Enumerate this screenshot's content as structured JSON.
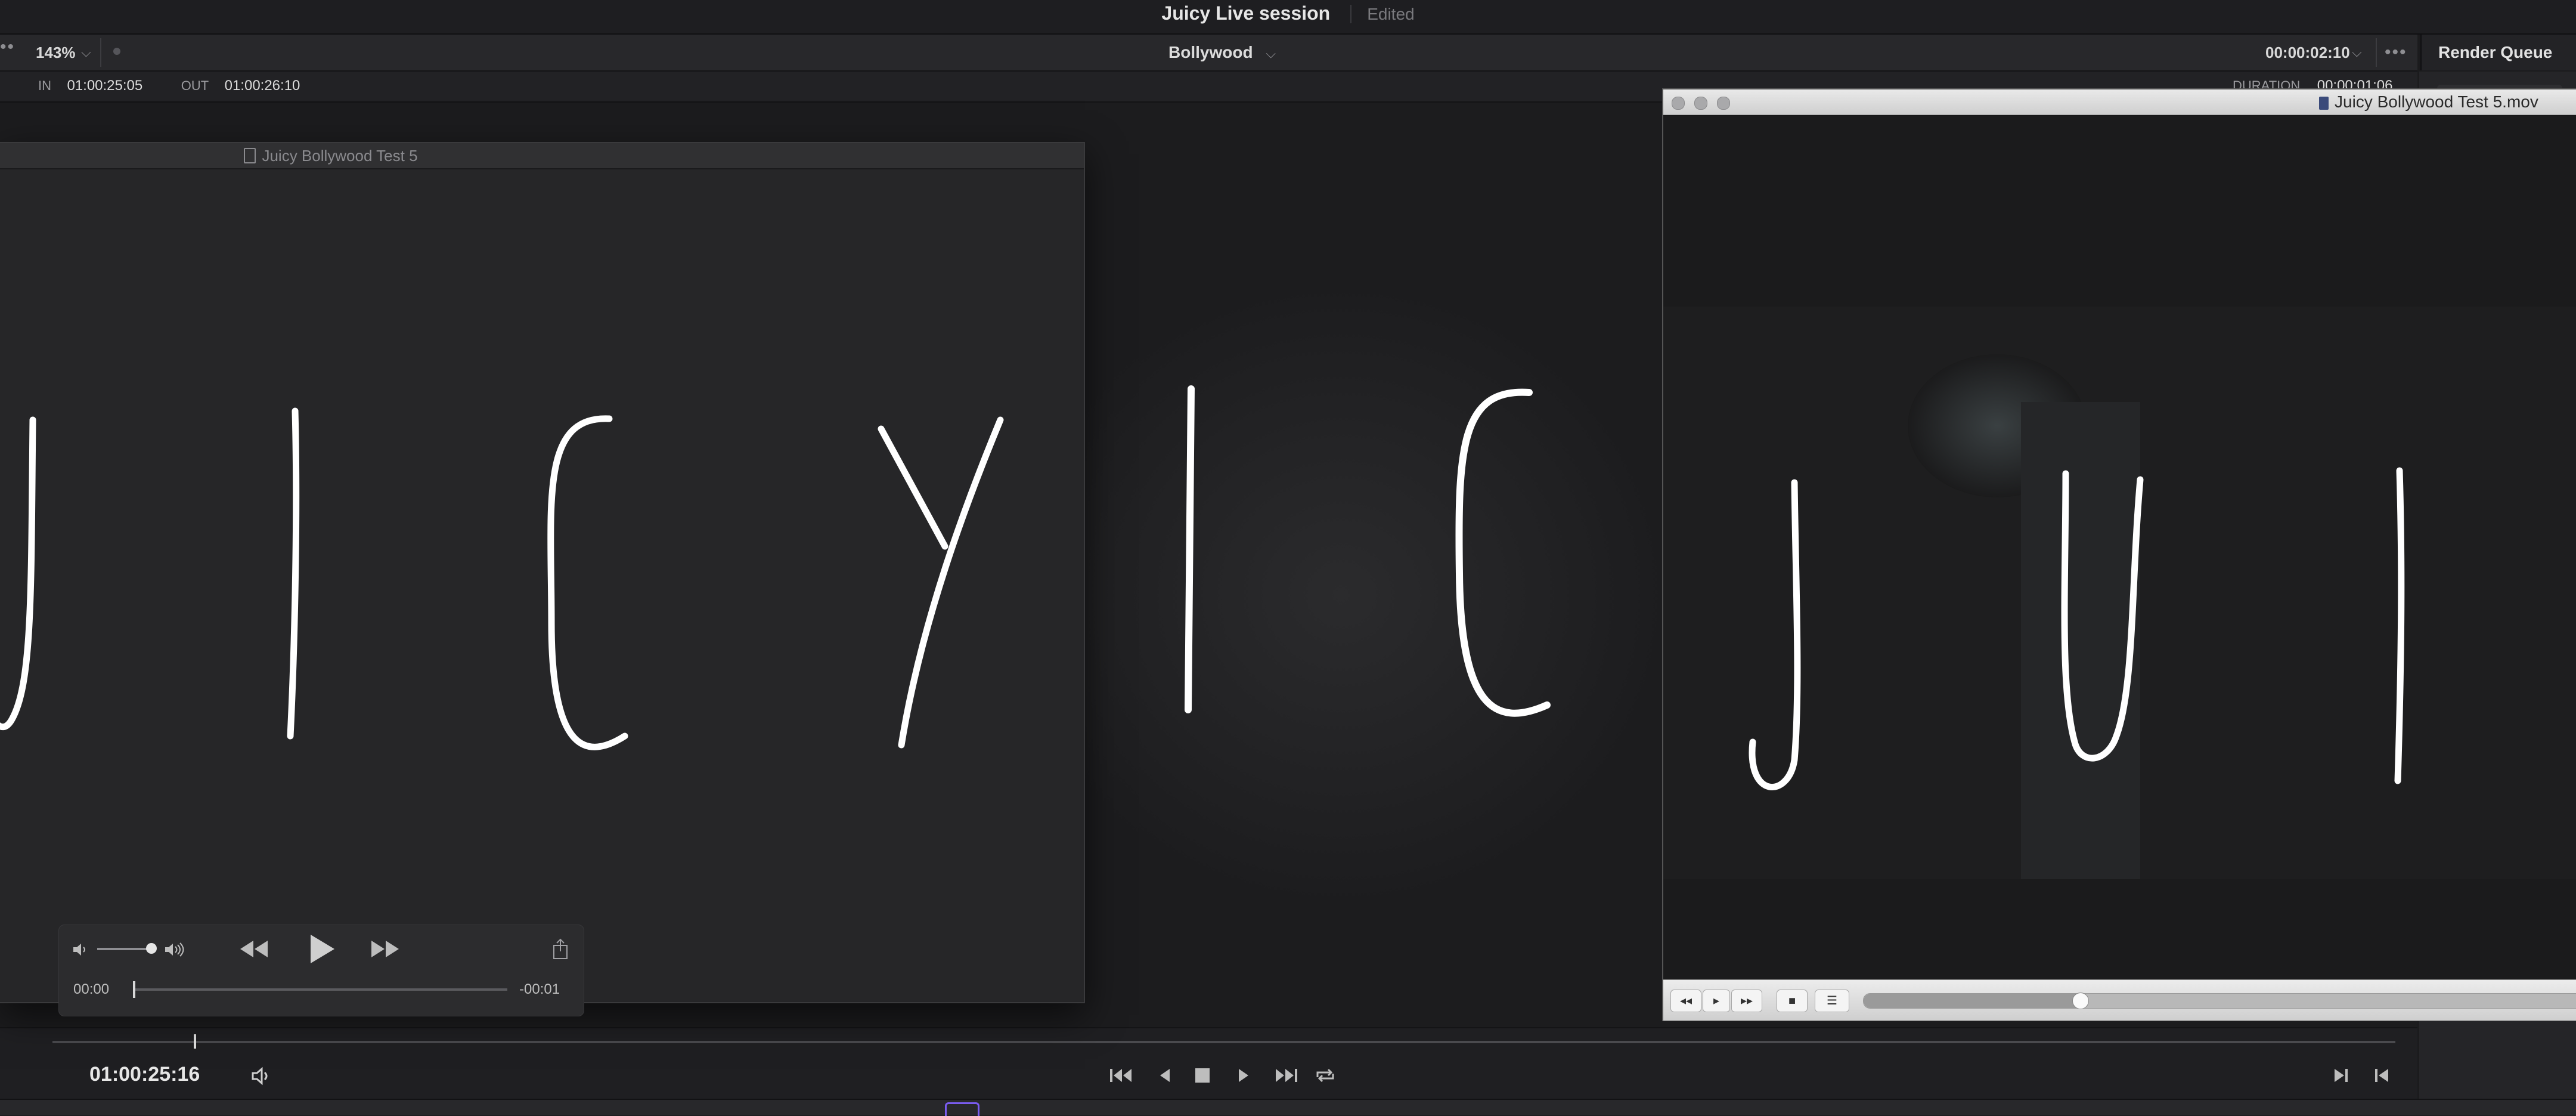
{
  "app": {
    "title": "Juicy Live session",
    "status": "Edited"
  },
  "viewer_header": {
    "zoom": "143%",
    "timeline_name": "Bollywood",
    "timecode": "00:00:02:10",
    "render_queue": "Render Queue",
    "duration_label": "DURATION",
    "duration_value": "00:00:01:06"
  },
  "in_out": {
    "in_label": "IN",
    "in_value": "01:00:25:05",
    "out_label": "OUT",
    "out_value": "01:00:26:10"
  },
  "transport": {
    "current_timecode": "01:00:25:16",
    "playhead_fraction": 0.06,
    "icons": [
      "speaker-icon",
      "skip-to-start-icon",
      "step-back-icon",
      "stop-icon",
      "play-icon",
      "skip-to-end-icon",
      "loop-icon",
      "next-edit-icon",
      "prev-edit-icon"
    ]
  },
  "quicklook_window": {
    "title": "Juicy Bollywood Test 5",
    "video_text": "JUICY",
    "controls": {
      "elapsed": "00:00",
      "remaining": "-00:01",
      "volume_fraction": 1.0,
      "progress_fraction": 0.0
    }
  },
  "quicktime_window": {
    "title": "Juicy Bollywood Test 5.mov",
    "video_text": "JUI",
    "progress_fraction": 0.11
  },
  "background_video_text": "ICYICJUI",
  "colors": {
    "stroke": "#ffffff",
    "background": "#1b1b1d",
    "accent": "#7a5cf0"
  }
}
